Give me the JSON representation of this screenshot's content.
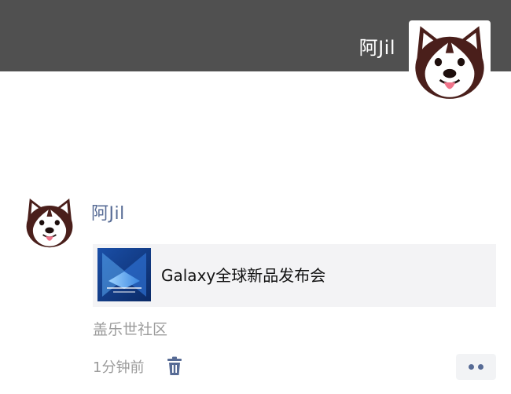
{
  "cover": {
    "username": "阿Jil",
    "avatar_icon": "husky-dog-avatar",
    "background_color": "#505050"
  },
  "post": {
    "author": "阿Jil",
    "avatar_icon": "husky-dog-avatar",
    "shared_link": {
      "title": "Galaxy全球新品发布会",
      "thumbnail_icon": "blue-abstract-thumbnail"
    },
    "source": "盖乐世社区",
    "timestamp": "1分钟前",
    "delete_icon": "trash-icon",
    "more_icon": "more-dots-icon"
  },
  "colors": {
    "author_link": "#576b95",
    "meta_text": "#9b9b9b",
    "card_background": "#f3f3f5"
  }
}
